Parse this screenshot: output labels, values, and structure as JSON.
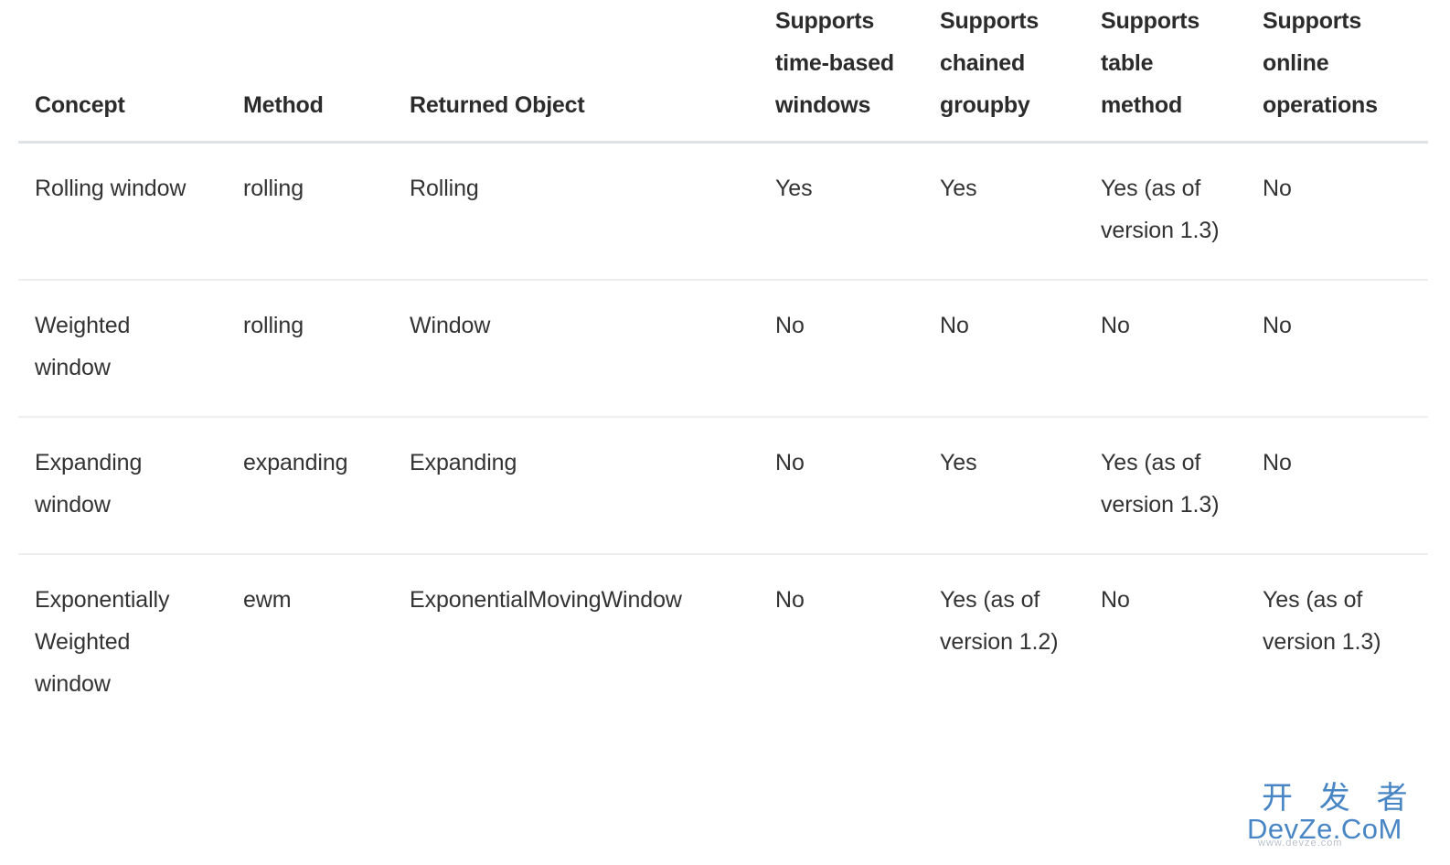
{
  "table": {
    "columns": [
      "Concept",
      "Method",
      "Returned Object",
      "Supports time-based windows",
      "Supports chained groupby",
      "Supports table method",
      "Supports online operations"
    ],
    "rows": [
      {
        "concept": "Rolling window",
        "method": "rolling",
        "returned_object": "Rolling",
        "supports_time_based_windows": "Yes",
        "supports_chained_groupby": "Yes",
        "supports_table_method": "Yes (as of version 1.3)",
        "supports_online_operations": "No"
      },
      {
        "concept": "Weighted window",
        "method": "rolling",
        "returned_object": "Window",
        "supports_time_based_windows": "No",
        "supports_chained_groupby": "No",
        "supports_table_method": "No",
        "supports_online_operations": "No"
      },
      {
        "concept": "Expanding window",
        "method": "expanding",
        "returned_object": "Expanding",
        "supports_time_based_windows": "No",
        "supports_chained_groupby": "Yes",
        "supports_table_method": "Yes (as of version 1.3)",
        "supports_online_operations": "No"
      },
      {
        "concept": "Exponentially Weighted window",
        "method": "ewm",
        "returned_object": "ExponentialMovingWindow",
        "supports_time_based_windows": "No",
        "supports_chained_groupby": "Yes (as of version 1.2)",
        "supports_table_method": "No",
        "supports_online_operations": "Yes (as of version 1.3)"
      }
    ]
  },
  "watermark": {
    "cjk_text": "开 发 者",
    "latin_text": "DevZe.CoM",
    "sub_text": "www.devze.com",
    "color": "#3f7fc1"
  },
  "theme": {
    "code_color": "#d6336c",
    "text_color": "#333333",
    "header_text_color": "#2b2b2b",
    "header_rule_color": "#dfe2e5",
    "row_rule_color": "#eceef0",
    "background": "#ffffff"
  }
}
